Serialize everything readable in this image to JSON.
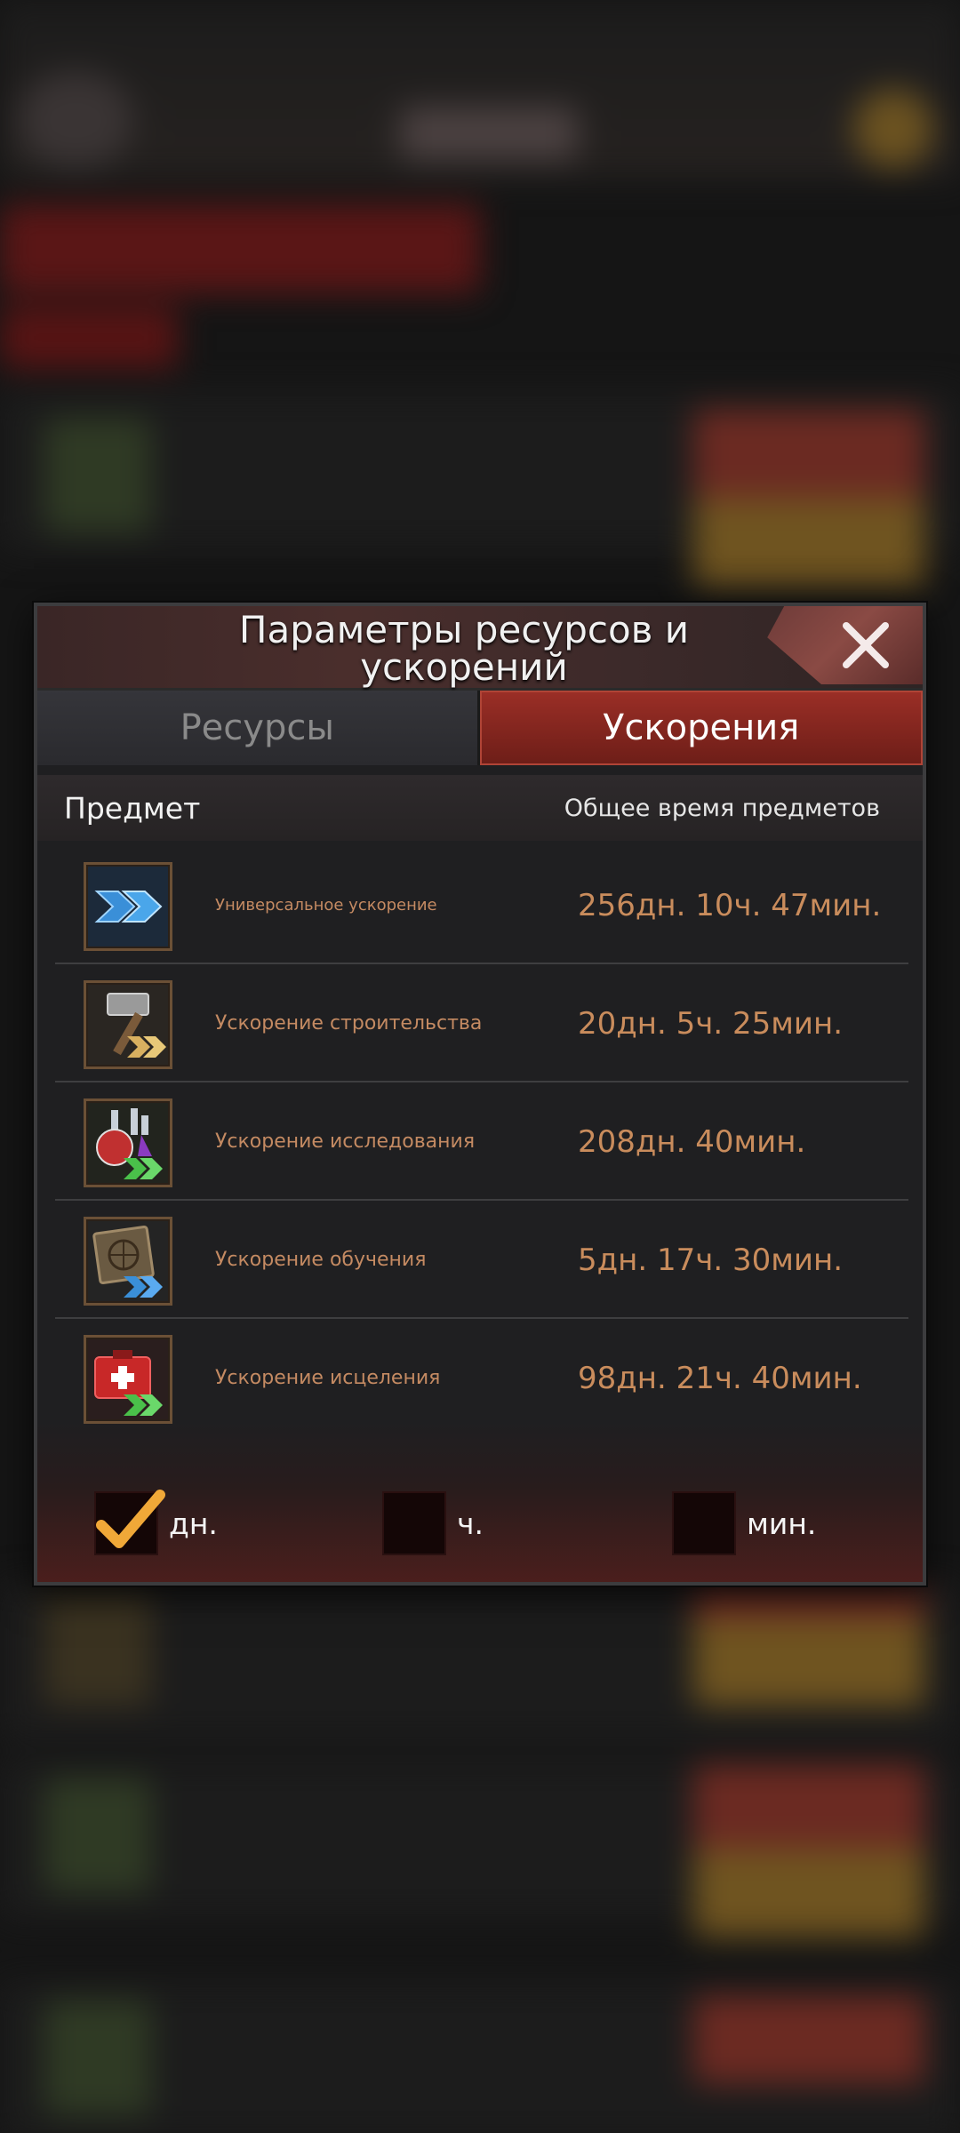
{
  "modal": {
    "title": "Параметры ресурсов и ускорений",
    "tabs": [
      {
        "label": "Ресурсы",
        "active": false
      },
      {
        "label": "Ускорения",
        "active": true
      }
    ],
    "columns": {
      "item": "Предмет",
      "total_time": "Общее время предметов"
    },
    "items": [
      {
        "name": "Универсальное ускорение",
        "time": "256дн. 10ч. 47мин.",
        "icon": "universal-speedup-icon"
      },
      {
        "name": "Ускорение строительства",
        "time": "20дн. 5ч. 25мин.",
        "icon": "construction-speedup-icon"
      },
      {
        "name": "Ускорение исследования",
        "time": "208дн. 40мин.",
        "icon": "research-speedup-icon"
      },
      {
        "name": "Ускорение обучения",
        "time": "5дн. 17ч. 30мин.",
        "icon": "training-speedup-icon"
      },
      {
        "name": "Ускорение исцеления",
        "time": "98дн. 21ч. 40мин.",
        "icon": "healing-speedup-icon"
      }
    ],
    "units": [
      {
        "label": "дн.",
        "checked": true
      },
      {
        "label": "ч.",
        "checked": false
      },
      {
        "label": "мин.",
        "checked": false
      }
    ]
  },
  "colors": {
    "accent_red": "#8c2820",
    "time_text": "#c98c5c",
    "check": "#f0a838"
  }
}
